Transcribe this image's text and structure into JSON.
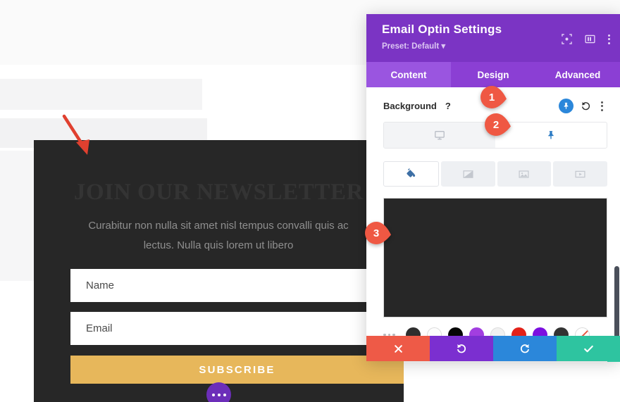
{
  "theme": {
    "panel_header_purple": "#7b34c4",
    "panel_tabs_purple": "#8b3fd4",
    "panel_tab_active_purple": "#9a55e0",
    "accent_blue": "#2b87da",
    "badge_red": "#ef5843",
    "arrow_red": "#e0402f",
    "optin_dark": "#272727",
    "subscribe_gold": "#e7b75b",
    "action_close_red": "#ee5a47",
    "action_undo_purple": "#7b2fd0",
    "action_redo_blue": "#2b87da",
    "action_save_teal": "#2ec4a0"
  },
  "canvas": {
    "optin": {
      "heading": "JOIN OUR NEWSLETTER",
      "subtext": "Curabitur non nulla sit amet nisl tempus convalli quis ac lectus. Nulla quis lorem ut libero",
      "name_placeholder": "Name",
      "email_placeholder": "Email",
      "submit_label": "SUBSCRIBE",
      "more_options_icon": "ellipsis-icon"
    },
    "annotation_arrow_icon": "red-arrow-icon"
  },
  "panel": {
    "title": "Email Optin Settings",
    "preset": "Preset: Default",
    "preset_caret": "▾",
    "header_icons": [
      {
        "name": "expand-icon",
        "glyph": "expand"
      },
      {
        "name": "layout-columns-icon",
        "glyph": "columns"
      },
      {
        "name": "more-menu-icon",
        "glyph": "dots"
      }
    ],
    "tabs": [
      {
        "label": "Content",
        "active": true
      },
      {
        "label": "Design",
        "active": false
      },
      {
        "label": "Advanced",
        "active": false
      }
    ],
    "background_section": {
      "label": "Background",
      "help_glyph": "?",
      "pin_icon": "pin-icon",
      "reset_icon": "undo-reset-icon",
      "menu_icon": "vertical-dots-icon"
    },
    "responsive_toggle": {
      "segments": [
        {
          "name": "desktop-icon",
          "active": false
        },
        {
          "name": "pin-hover-icon",
          "active": true
        }
      ]
    },
    "background_type_tabs": [
      {
        "name": "background-color-icon",
        "active": true
      },
      {
        "name": "background-gradient-icon",
        "active": false
      },
      {
        "name": "background-image-icon",
        "active": false
      },
      {
        "name": "background-video-icon",
        "active": false
      }
    ],
    "color_preview": {
      "value": "#272727"
    },
    "swatches": {
      "more_icon": "swatch-more-icon",
      "colors": [
        "#2e2e2e",
        "#fdfdfd",
        "#060606",
        "#a23ee0",
        "#f1f1f1",
        "#e32119",
        "#7b0fe0",
        "#333333"
      ],
      "transparent_label": "none-icon"
    },
    "actions": [
      {
        "name": "close-button",
        "icon": "close-x-icon",
        "color": "#ee5a47"
      },
      {
        "name": "undo-button",
        "icon": "undo-icon",
        "color": "#7b2fd0"
      },
      {
        "name": "redo-button",
        "icon": "redo-icon",
        "color": "#2b87da"
      },
      {
        "name": "save-button",
        "icon": "check-icon",
        "color": "#2ec4a0"
      }
    ],
    "scrollbar": "panel-scrollbar"
  },
  "callouts": [
    {
      "number": "1"
    },
    {
      "number": "2"
    },
    {
      "number": "3"
    }
  ]
}
